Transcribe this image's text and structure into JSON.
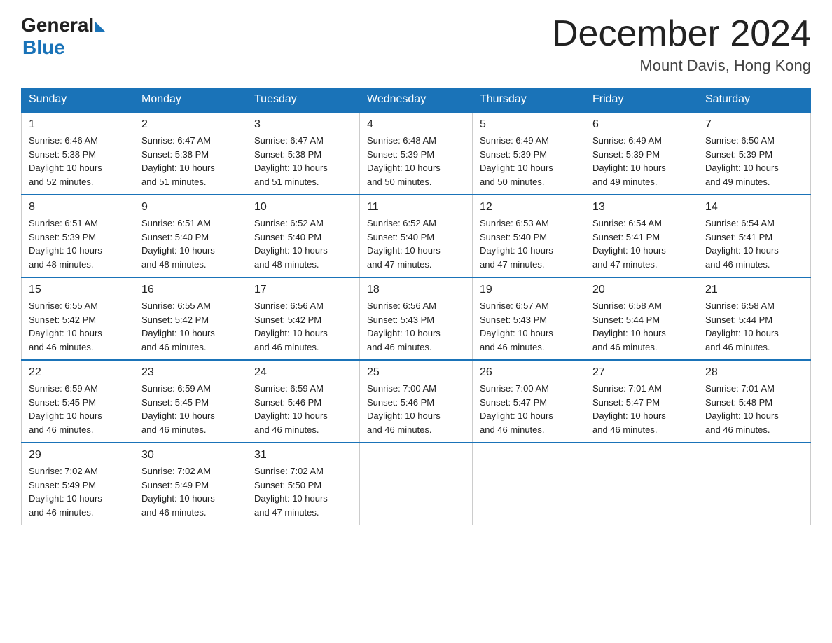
{
  "header": {
    "logo_general": "General",
    "logo_blue": "Blue",
    "month_year": "December 2024",
    "location": "Mount Davis, Hong Kong"
  },
  "days_of_week": [
    "Sunday",
    "Monday",
    "Tuesday",
    "Wednesday",
    "Thursday",
    "Friday",
    "Saturday"
  ],
  "weeks": [
    [
      {
        "num": "1",
        "sunrise": "6:46 AM",
        "sunset": "5:38 PM",
        "daylight": "10 hours and 52 minutes."
      },
      {
        "num": "2",
        "sunrise": "6:47 AM",
        "sunset": "5:38 PM",
        "daylight": "10 hours and 51 minutes."
      },
      {
        "num": "3",
        "sunrise": "6:47 AM",
        "sunset": "5:38 PM",
        "daylight": "10 hours and 51 minutes."
      },
      {
        "num": "4",
        "sunrise": "6:48 AM",
        "sunset": "5:39 PM",
        "daylight": "10 hours and 50 minutes."
      },
      {
        "num": "5",
        "sunrise": "6:49 AM",
        "sunset": "5:39 PM",
        "daylight": "10 hours and 50 minutes."
      },
      {
        "num": "6",
        "sunrise": "6:49 AM",
        "sunset": "5:39 PM",
        "daylight": "10 hours and 49 minutes."
      },
      {
        "num": "7",
        "sunrise": "6:50 AM",
        "sunset": "5:39 PM",
        "daylight": "10 hours and 49 minutes."
      }
    ],
    [
      {
        "num": "8",
        "sunrise": "6:51 AM",
        "sunset": "5:39 PM",
        "daylight": "10 hours and 48 minutes."
      },
      {
        "num": "9",
        "sunrise": "6:51 AM",
        "sunset": "5:40 PM",
        "daylight": "10 hours and 48 minutes."
      },
      {
        "num": "10",
        "sunrise": "6:52 AM",
        "sunset": "5:40 PM",
        "daylight": "10 hours and 48 minutes."
      },
      {
        "num": "11",
        "sunrise": "6:52 AM",
        "sunset": "5:40 PM",
        "daylight": "10 hours and 47 minutes."
      },
      {
        "num": "12",
        "sunrise": "6:53 AM",
        "sunset": "5:40 PM",
        "daylight": "10 hours and 47 minutes."
      },
      {
        "num": "13",
        "sunrise": "6:54 AM",
        "sunset": "5:41 PM",
        "daylight": "10 hours and 47 minutes."
      },
      {
        "num": "14",
        "sunrise": "6:54 AM",
        "sunset": "5:41 PM",
        "daylight": "10 hours and 46 minutes."
      }
    ],
    [
      {
        "num": "15",
        "sunrise": "6:55 AM",
        "sunset": "5:42 PM",
        "daylight": "10 hours and 46 minutes."
      },
      {
        "num": "16",
        "sunrise": "6:55 AM",
        "sunset": "5:42 PM",
        "daylight": "10 hours and 46 minutes."
      },
      {
        "num": "17",
        "sunrise": "6:56 AM",
        "sunset": "5:42 PM",
        "daylight": "10 hours and 46 minutes."
      },
      {
        "num": "18",
        "sunrise": "6:56 AM",
        "sunset": "5:43 PM",
        "daylight": "10 hours and 46 minutes."
      },
      {
        "num": "19",
        "sunrise": "6:57 AM",
        "sunset": "5:43 PM",
        "daylight": "10 hours and 46 minutes."
      },
      {
        "num": "20",
        "sunrise": "6:58 AM",
        "sunset": "5:44 PM",
        "daylight": "10 hours and 46 minutes."
      },
      {
        "num": "21",
        "sunrise": "6:58 AM",
        "sunset": "5:44 PM",
        "daylight": "10 hours and 46 minutes."
      }
    ],
    [
      {
        "num": "22",
        "sunrise": "6:59 AM",
        "sunset": "5:45 PM",
        "daylight": "10 hours and 46 minutes."
      },
      {
        "num": "23",
        "sunrise": "6:59 AM",
        "sunset": "5:45 PM",
        "daylight": "10 hours and 46 minutes."
      },
      {
        "num": "24",
        "sunrise": "6:59 AM",
        "sunset": "5:46 PM",
        "daylight": "10 hours and 46 minutes."
      },
      {
        "num": "25",
        "sunrise": "7:00 AM",
        "sunset": "5:46 PM",
        "daylight": "10 hours and 46 minutes."
      },
      {
        "num": "26",
        "sunrise": "7:00 AM",
        "sunset": "5:47 PM",
        "daylight": "10 hours and 46 minutes."
      },
      {
        "num": "27",
        "sunrise": "7:01 AM",
        "sunset": "5:47 PM",
        "daylight": "10 hours and 46 minutes."
      },
      {
        "num": "28",
        "sunrise": "7:01 AM",
        "sunset": "5:48 PM",
        "daylight": "10 hours and 46 minutes."
      }
    ],
    [
      {
        "num": "29",
        "sunrise": "7:02 AM",
        "sunset": "5:49 PM",
        "daylight": "10 hours and 46 minutes."
      },
      {
        "num": "30",
        "sunrise": "7:02 AM",
        "sunset": "5:49 PM",
        "daylight": "10 hours and 46 minutes."
      },
      {
        "num": "31",
        "sunrise": "7:02 AM",
        "sunset": "5:50 PM",
        "daylight": "10 hours and 47 minutes."
      },
      null,
      null,
      null,
      null
    ]
  ],
  "labels": {
    "sunrise": "Sunrise:",
    "sunset": "Sunset:",
    "daylight": "Daylight:"
  }
}
